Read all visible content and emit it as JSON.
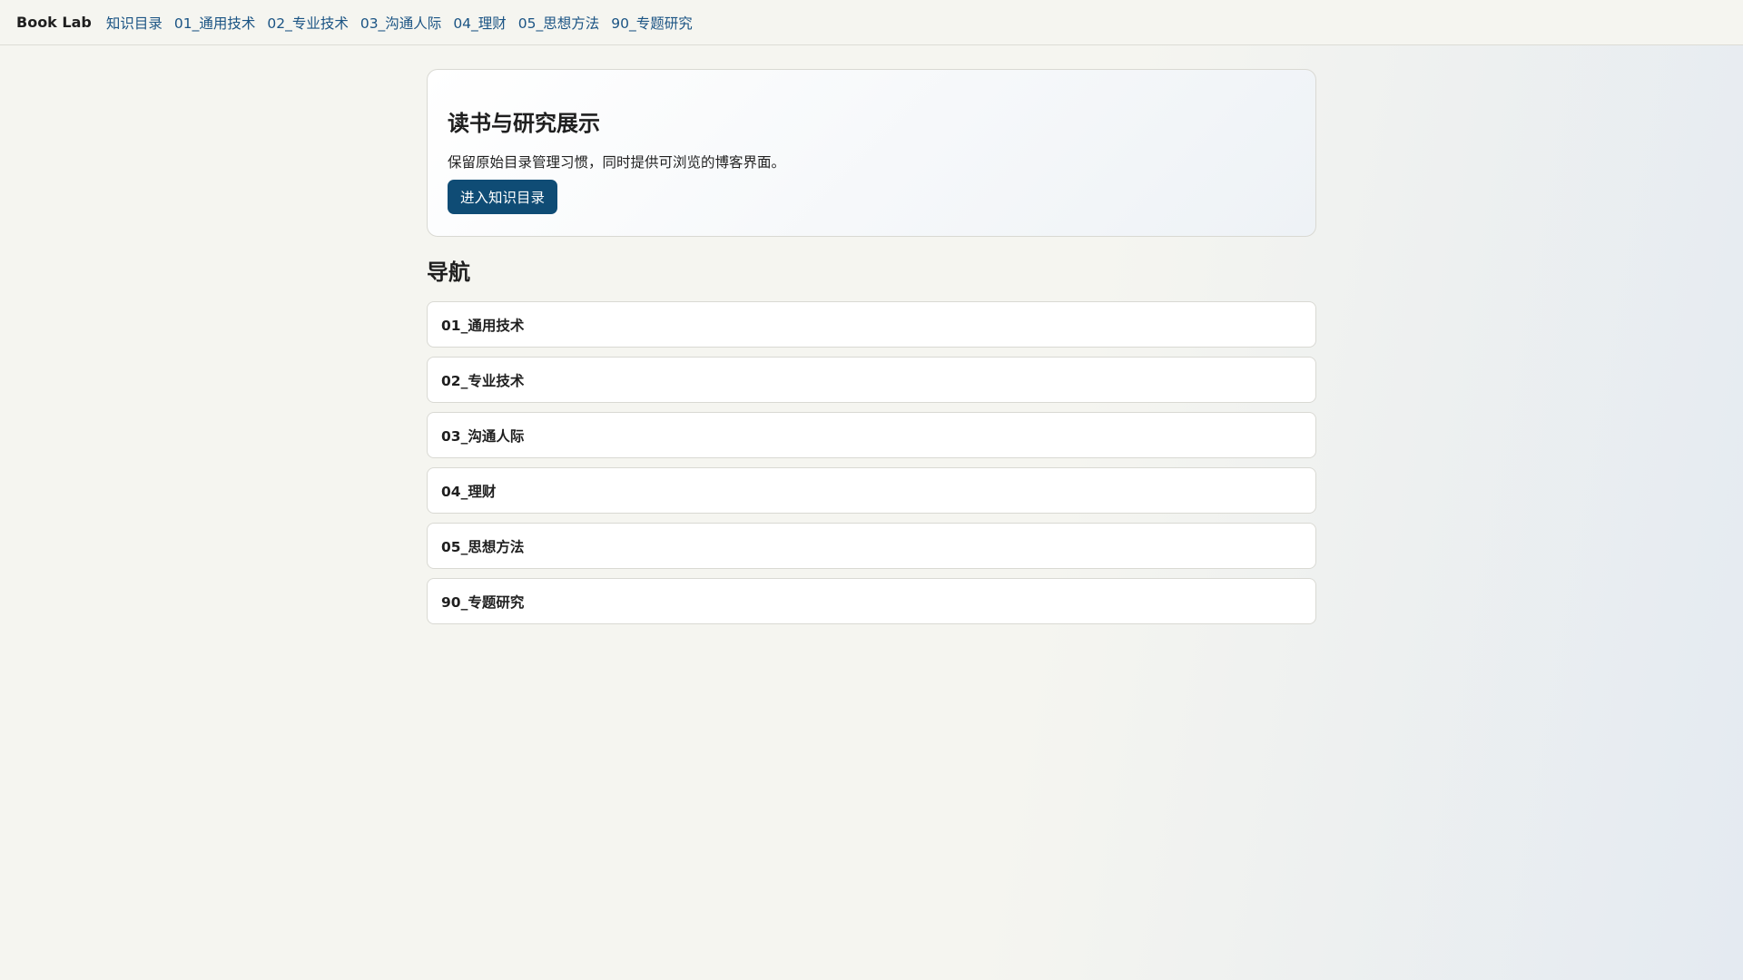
{
  "header": {
    "brand": "Book Lab",
    "links": [
      "知识目录",
      "01_通用技术",
      "02_专业技术",
      "03_沟通人际",
      "04_理财",
      "05_思想方法",
      "90_专题研究"
    ]
  },
  "hero": {
    "title": "读书与研究展示",
    "subtitle": "保留原始目录管理习惯，同时提供可浏览的博客界面。",
    "button": "进入知识目录"
  },
  "nav": {
    "heading": "导航",
    "items": [
      "01_通用技术",
      "02_专业技术",
      "03_沟通人际",
      "04_理财",
      "05_思想方法",
      "90_专题研究"
    ]
  }
}
